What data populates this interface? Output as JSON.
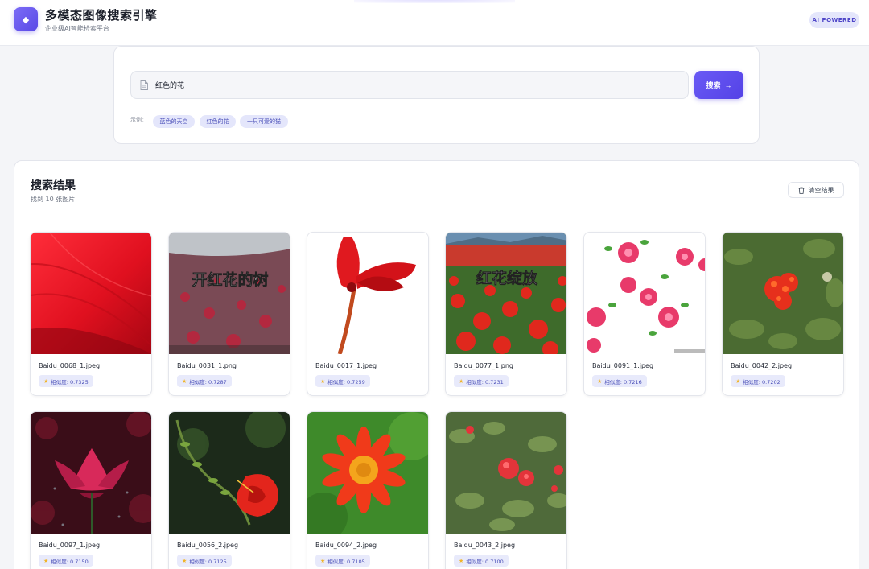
{
  "header": {
    "title": "多模态图像搜索引擎",
    "subtitle": "企业级AI智能检索平台",
    "badge": "AI POWERED",
    "logo_icon": "sparkle-icon",
    "accent": "#5a49e6"
  },
  "search": {
    "value": "红色的花",
    "button_label": "搜索",
    "button_arrow": "→",
    "examples_label": "示例：",
    "examples": [
      "蓝色的天空",
      "红色的花",
      "一只可爱的猫"
    ]
  },
  "results": {
    "title": "搜索结果",
    "count": "找到 10 张图片",
    "clear_label": "清空结果",
    "items": [
      {
        "name": "Baidu_0068_1.jpeg",
        "similarity": "相似度: 0.7325"
      },
      {
        "name": "Baidu_0031_1.png",
        "similarity": "相似度: 0.7287",
        "overlay": "开红花的树"
      },
      {
        "name": "Baidu_0017_1.jpeg",
        "similarity": "相似度: 0.7259"
      },
      {
        "name": "Baidu_0077_1.png",
        "similarity": "相似度: 0.7231",
        "overlay": "红花绽放"
      },
      {
        "name": "Baidu_0091_1.jpeg",
        "similarity": "相似度: 0.7216"
      },
      {
        "name": "Baidu_0042_2.jpeg",
        "similarity": "相似度: 0.7202"
      },
      {
        "name": "Baidu_0097_1.jpeg",
        "similarity": "相似度: 0.7150"
      },
      {
        "name": "Baidu_0056_2.jpeg",
        "similarity": "相似度: 0.7125"
      },
      {
        "name": "Baidu_0094_2.jpeg",
        "similarity": "相似度: 0.7105"
      },
      {
        "name": "Baidu_0043_2.jpeg",
        "similarity": "相似度: 0.7100"
      }
    ]
  }
}
